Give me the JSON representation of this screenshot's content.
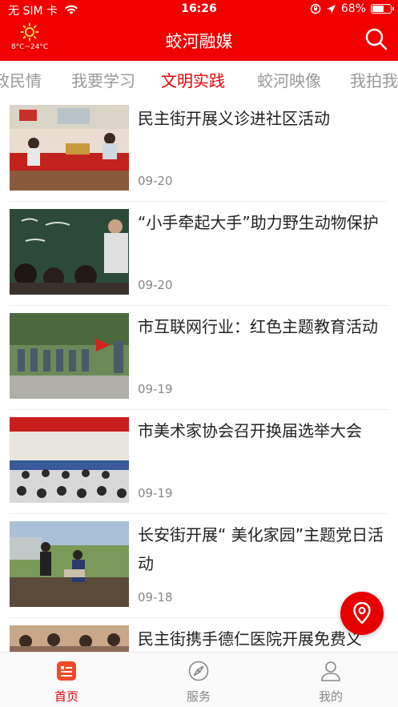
{
  "status": {
    "carrier": "无 SIM 卡",
    "time": "16:26",
    "battery": "68%",
    "battery_level": 0.68
  },
  "header": {
    "title": "蛟河融媒",
    "weather_temp": "8°C~24°C"
  },
  "tabs": [
    {
      "label": "政民情"
    },
    {
      "label": "我要学习"
    },
    {
      "label": "文明实践"
    },
    {
      "label": "蛟河映像"
    },
    {
      "label": "我拍我"
    }
  ],
  "news": [
    {
      "title": "民主街开展义诊进社区活动",
      "date": "09-20"
    },
    {
      "title": "“小手牵起大手”助力野生动物保护",
      "date": "09-20"
    },
    {
      "title": "市互联网行业：红色主题教育活动",
      "date": "09-19"
    },
    {
      "title": "市美术家协会召开换届选举大会",
      "date": "09-19"
    },
    {
      "title": "长安街开展“ 美化家园”主题党日活动",
      "date": "09-18"
    },
    {
      "title": "民主街携手德仁医院开展免费义",
      "date": ""
    }
  ],
  "tabbar": [
    {
      "label": "首页"
    },
    {
      "label": "服务"
    },
    {
      "label": "我的"
    }
  ]
}
